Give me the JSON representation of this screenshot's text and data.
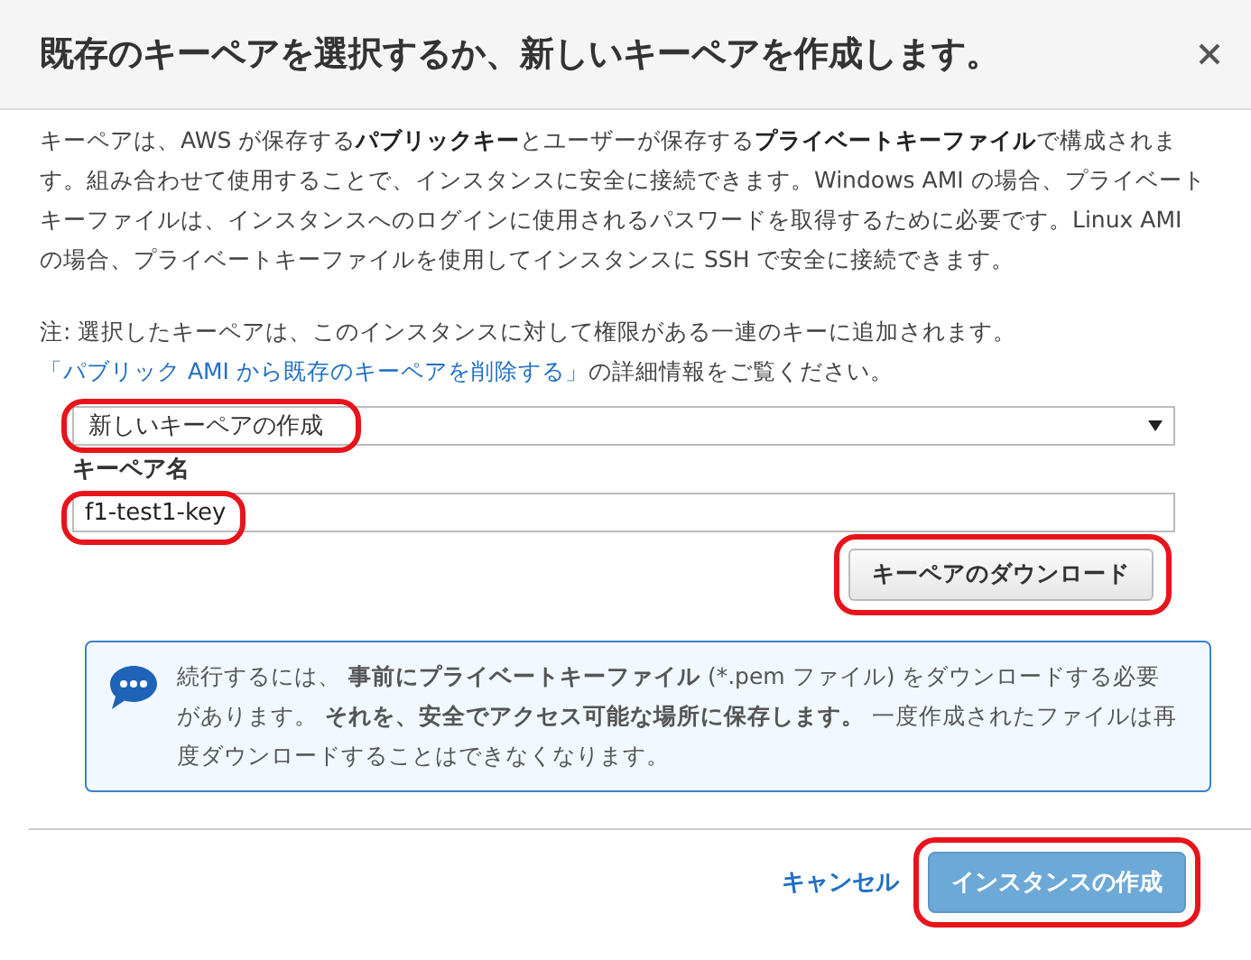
{
  "dialog": {
    "title": "既存のキーペアを選択するか、新しいキーペアを作成します。"
  },
  "description": "キーペアは、AWS が保存する**パブリックキー**とユーザーが保存する**プライベートキーファイル**で構成されます。組み合わせて使用することで、インスタンスに安全に接続できます。Windows AMI の場合、プライベートキーファイルは、インスタンスへのログインに使用されるパスワードを取得するために必要です。Linux AMI の場合、プライベートキーファイルを使用してインスタンスに SSH で安全に接続できます。",
  "note": {
    "before": "注: 選択したキーペアは、このインスタンスに対して権限がある一連のキーに追加されます。",
    "link": "「パブリック AMI から既存のキーペアを削除する」",
    "after": "の詳細情報をご覧ください。"
  },
  "keypair_select": {
    "value": "新しいキーペアの作成",
    "highlighted": true
  },
  "keypair_name": {
    "label": "キーペア名",
    "value": "f1-test1-key",
    "highlighted": true
  },
  "download_button": {
    "label": "キーペアのダウンロード",
    "highlighted": true
  },
  "info": {
    "text": "続行するには、 **事前にプライベートキーファイル** (*.pem ファイル) をダウンロードする必要があります。 **それを、安全でアクセス可能な場所に保存します。** 一度作成されたファイルは再度ダウンロードすることはできなくなります。"
  },
  "footer": {
    "cancel": "キャンセル",
    "create": {
      "label": "インスタンスの作成",
      "disabled": true,
      "highlighted": true
    }
  }
}
